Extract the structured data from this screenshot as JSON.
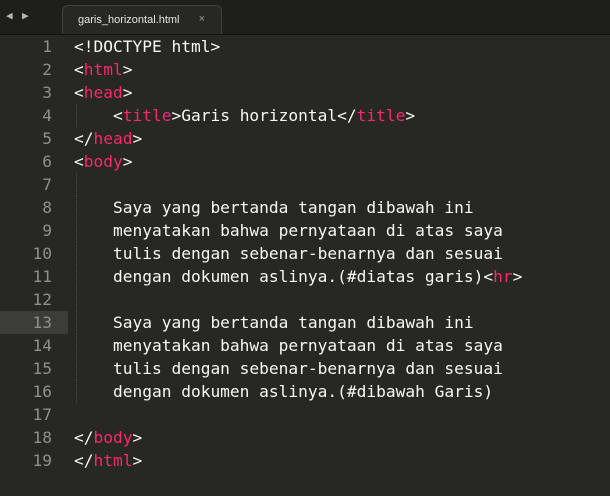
{
  "tabbar": {
    "prev_icon": "◀",
    "next_icon": "▶",
    "tab_label": "garis_horizontal.html",
    "close_icon": "×"
  },
  "editor": {
    "colors": {
      "background": "#272822",
      "tag": "#f92672",
      "text": "#f8f8f2",
      "gutter_text": "#8f908a"
    },
    "highlighted_line": 13,
    "lines": [
      {
        "n": "1",
        "parts": [
          {
            "t": "<!DOCTYPE html>",
            "c": "punc"
          }
        ]
      },
      {
        "n": "2",
        "parts": [
          {
            "t": "<",
            "c": "punc"
          },
          {
            "t": "html",
            "c": "tag"
          },
          {
            "t": ">",
            "c": "punc"
          }
        ]
      },
      {
        "n": "3",
        "parts": [
          {
            "t": "<",
            "c": "punc"
          },
          {
            "t": "head",
            "c": "tag"
          },
          {
            "t": ">",
            "c": "punc"
          }
        ]
      },
      {
        "n": "4",
        "parts": [
          {
            "t": "    <",
            "c": "punc"
          },
          {
            "t": "title",
            "c": "tag"
          },
          {
            "t": ">Garis horizontal</",
            "c": "punc"
          },
          {
            "t": "title",
            "c": "tag"
          },
          {
            "t": ">",
            "c": "punc"
          }
        ]
      },
      {
        "n": "5",
        "parts": [
          {
            "t": "</",
            "c": "punc"
          },
          {
            "t": "head",
            "c": "tag"
          },
          {
            "t": ">",
            "c": "punc"
          }
        ]
      },
      {
        "n": "6",
        "parts": [
          {
            "t": "<",
            "c": "punc"
          },
          {
            "t": "body",
            "c": "tag"
          },
          {
            "t": ">",
            "c": "punc"
          }
        ]
      },
      {
        "n": "7",
        "parts": []
      },
      {
        "n": "8",
        "parts": [
          {
            "t": "    Saya yang bertanda tangan dibawah ini",
            "c": "punc"
          }
        ]
      },
      {
        "n": "9",
        "parts": [
          {
            "t": "    menyatakan bahwa pernyataan di atas saya",
            "c": "punc"
          }
        ]
      },
      {
        "n": "10",
        "parts": [
          {
            "t": "    tulis dengan sebenar-benarnya dan sesuai",
            "c": "punc"
          }
        ]
      },
      {
        "n": "11",
        "parts": [
          {
            "t": "    dengan dokumen aslinya.(#diatas garis)<",
            "c": "punc"
          },
          {
            "t": "hr",
            "c": "tag"
          },
          {
            "t": ">",
            "c": "punc"
          }
        ]
      },
      {
        "n": "12",
        "parts": []
      },
      {
        "n": "13",
        "parts": [
          {
            "t": "    Saya yang bertanda tangan dibawah ini",
            "c": "punc"
          }
        ]
      },
      {
        "n": "14",
        "parts": [
          {
            "t": "    menyatakan bahwa pernyataan di atas saya",
            "c": "punc"
          }
        ]
      },
      {
        "n": "15",
        "parts": [
          {
            "t": "    tulis dengan sebenar-benarnya dan sesuai",
            "c": "punc"
          }
        ]
      },
      {
        "n": "16",
        "parts": [
          {
            "t": "    dengan dokumen aslinya.(#dibawah Garis)",
            "c": "punc"
          }
        ]
      },
      {
        "n": "17",
        "parts": []
      },
      {
        "n": "18",
        "parts": [
          {
            "t": "</",
            "c": "punc"
          },
          {
            "t": "body",
            "c": "tag"
          },
          {
            "t": ">",
            "c": "punc"
          }
        ]
      },
      {
        "n": "19",
        "parts": [
          {
            "t": "</",
            "c": "punc"
          },
          {
            "t": "html",
            "c": "tag"
          },
          {
            "t": ">",
            "c": "punc"
          }
        ]
      }
    ]
  }
}
